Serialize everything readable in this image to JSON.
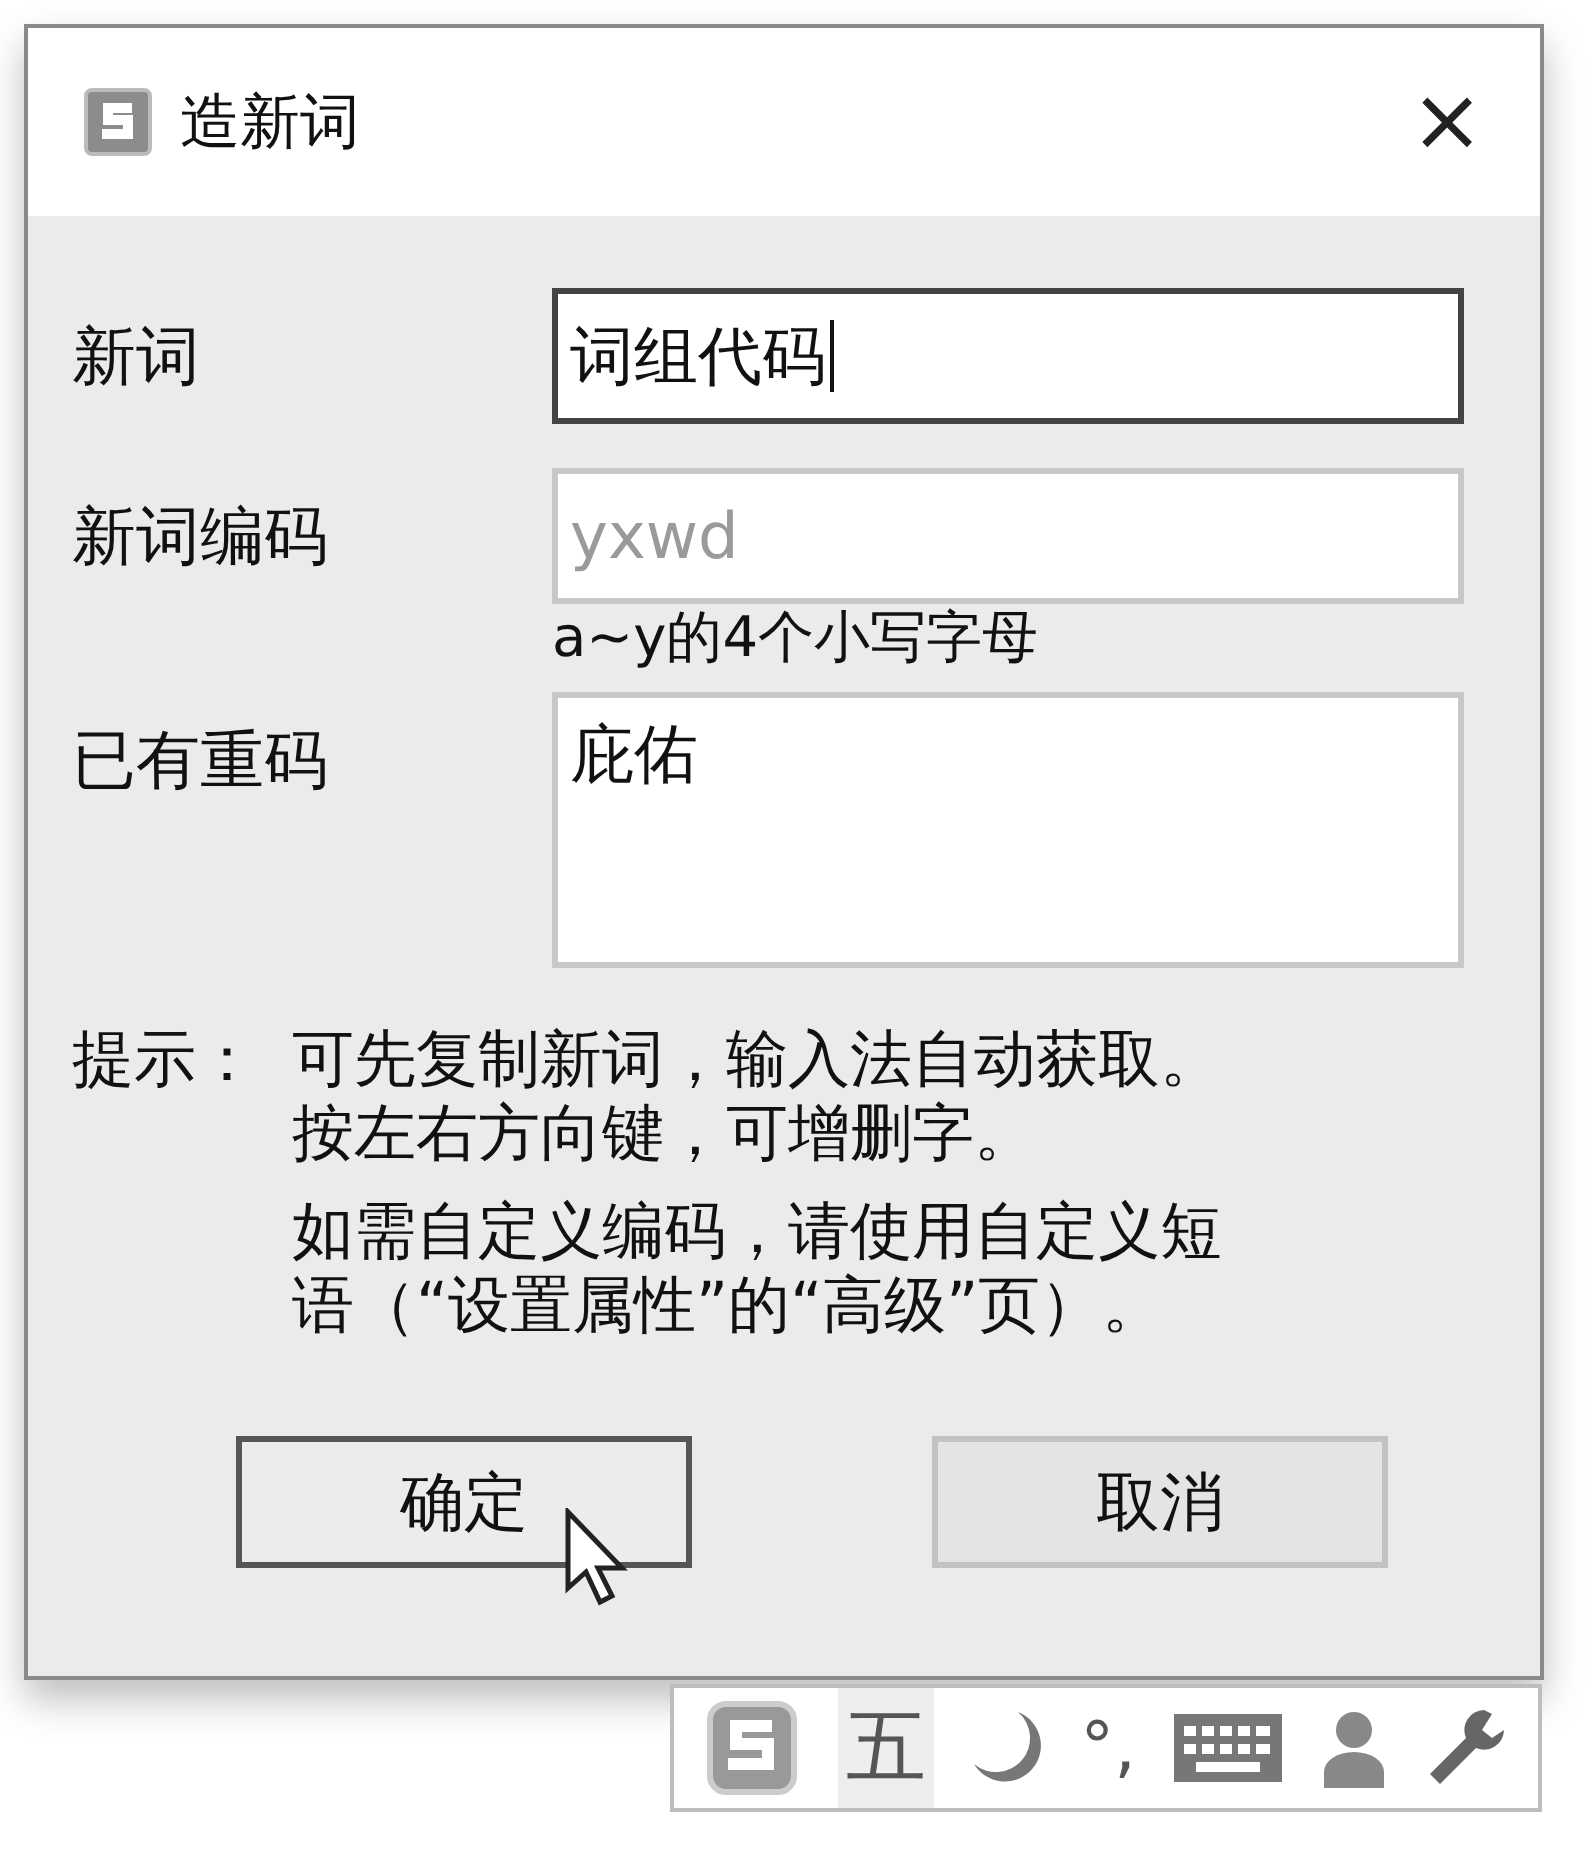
{
  "window": {
    "title": "造新词",
    "close": "×"
  },
  "fields": [
    {
      "label": "新词",
      "kind": "input",
      "value": "词组代码",
      "focused": true
    },
    {
      "label": "新词编码",
      "kind": "input",
      "placeholder": "yxwd",
      "focused": false,
      "hint": "a~y的4个小写字母"
    },
    {
      "label": "已有重码",
      "kind": "area",
      "value": "庇佑",
      "focused": false
    }
  ],
  "tip": {
    "label": "提示：",
    "paragraphs": [
      {
        "lines": [
          "可先复制新词，输入法自动获取。",
          "按左右方向键，可增删字。"
        ]
      },
      {
        "lines": [
          "如需自定义编码，请使用自定义短",
          "语（“设置属性”的“高级”页）。"
        ]
      }
    ]
  },
  "buttons": [
    {
      "label": "确定",
      "default": true
    },
    {
      "label": "取消",
      "default": false
    }
  ],
  "ime_toolbar": {
    "mode": "五",
    "punctuation": "°,"
  }
}
